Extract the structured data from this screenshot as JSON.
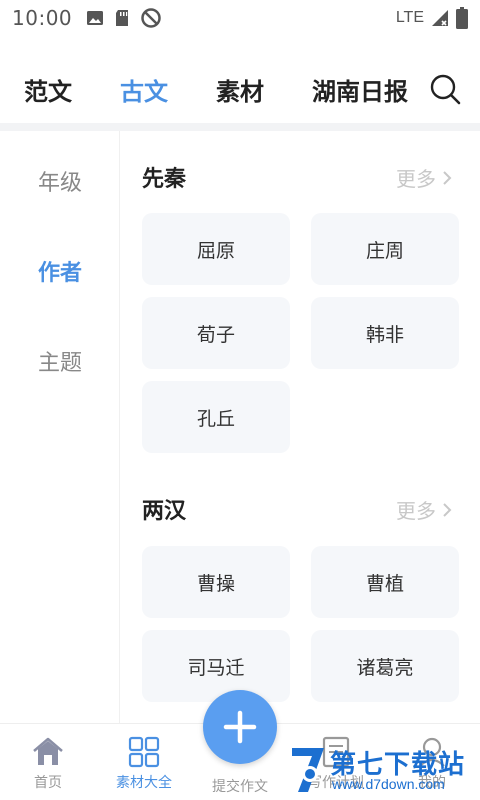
{
  "status_bar": {
    "time": "10:00",
    "network": "LTE"
  },
  "top_tabs": [
    {
      "label": "范文",
      "active": false
    },
    {
      "label": "古文",
      "active": true
    },
    {
      "label": "素材",
      "active": false
    },
    {
      "label": "湖南日报",
      "active": false
    }
  ],
  "side_nav": [
    {
      "label": "年级",
      "active": false
    },
    {
      "label": "作者",
      "active": true
    },
    {
      "label": "主题",
      "active": false
    }
  ],
  "sections": [
    {
      "title": "先秦",
      "more_label": "更多",
      "authors": [
        "屈原",
        "庄周",
        "荀子",
        "韩非",
        "孔丘"
      ]
    },
    {
      "title": "两汉",
      "more_label": "更多",
      "authors": [
        "曹操",
        "曹植",
        "司马迁",
        "诸葛亮"
      ]
    }
  ],
  "bottom_nav": [
    {
      "label": "首页",
      "icon": "home-icon"
    },
    {
      "label": "素材大全",
      "icon": "grid-icon"
    },
    {
      "label": "提交作文",
      "icon": "plus-icon"
    },
    {
      "label": "写作计划",
      "icon": "plan-icon"
    },
    {
      "label": "我的",
      "icon": "user-icon"
    }
  ],
  "watermark": {
    "text": "第七下载站",
    "url": "www.d7down.com"
  },
  "colors": {
    "accent": "#4a90e2",
    "card_bg": "#f5f7fa",
    "fab": "#5a9ef0"
  }
}
